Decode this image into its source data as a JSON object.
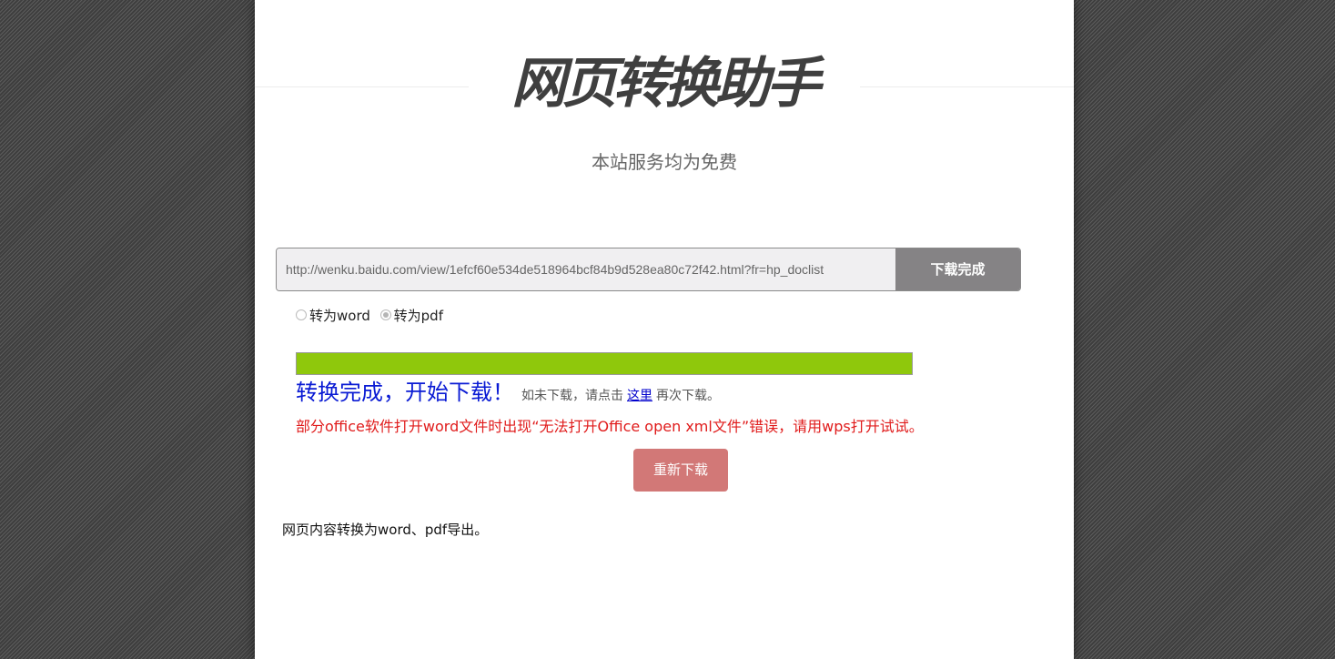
{
  "header": {
    "title": "网页转换助手",
    "subtitle": "本站服务均为免费"
  },
  "converter": {
    "url_value": "http://wenku.baidu.com/view/1efcf60e534de518964bcf84b9d528ea80c72f42.html?fr=hp_doclist",
    "button_label": "下载完成",
    "options": [
      {
        "label": "转为word",
        "checked": false
      },
      {
        "label": "转为pdf",
        "checked": true
      }
    ],
    "progress_percent": 100
  },
  "result": {
    "done_text": "转换完成，开始下载！",
    "hint_prefix": "如未下载，请点击",
    "hint_link": "这里",
    "hint_suffix": "再次下载。",
    "warning": "部分office软件打开word文件时出现“无法打开Office open xml文件”错误，请用wps打开试试。",
    "redownload_label": "重新下载"
  },
  "footer": {
    "description": "网页内容转换为word、pdf导出。"
  },
  "colors": {
    "progress_fill": "#8fc80c",
    "done_text": "#0a1bd4",
    "warning_text": "#e01b1b",
    "redownload_button": "#d27877",
    "download_button": "#858385"
  }
}
